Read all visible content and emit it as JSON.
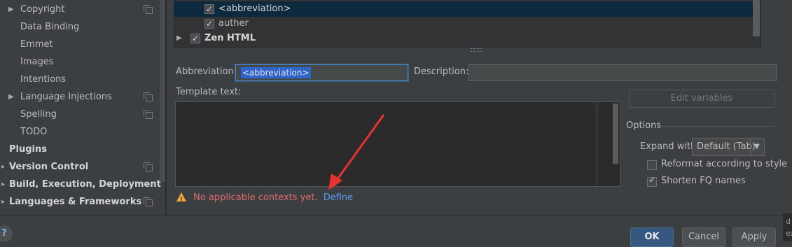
{
  "sidebar": {
    "items": [
      {
        "label": "Copyright",
        "arrow": "▶",
        "copy": true,
        "bold": false
      },
      {
        "label": "Data Binding",
        "arrow": "",
        "copy": false,
        "bold": false
      },
      {
        "label": "Emmet",
        "arrow": "",
        "copy": false,
        "bold": false
      },
      {
        "label": "Images",
        "arrow": "",
        "copy": false,
        "bold": false
      },
      {
        "label": "Intentions",
        "arrow": "",
        "copy": false,
        "bold": false
      },
      {
        "label": "Language Injections",
        "arrow": "▶",
        "copy": true,
        "bold": false
      },
      {
        "label": "Spelling",
        "arrow": "",
        "copy": true,
        "bold": false
      },
      {
        "label": "TODO",
        "arrow": "",
        "copy": false,
        "bold": false
      },
      {
        "label": "Plugins",
        "arrow": "",
        "copy": false,
        "bold": true
      },
      {
        "label": "Version Control",
        "arrow": "▸",
        "copy": true,
        "bold": true
      },
      {
        "label": "Build, Execution, Deployment",
        "arrow": "▸",
        "copy": false,
        "bold": true
      },
      {
        "label": "Languages & Frameworks",
        "arrow": "▸",
        "copy": true,
        "bold": true
      }
    ]
  },
  "tree": {
    "rows": [
      {
        "label": "<abbreviation>",
        "selected": true
      },
      {
        "label": "auther",
        "selected": false
      },
      {
        "label": "Zen HTML",
        "group": true
      }
    ]
  },
  "form": {
    "abbreviation_label": "Abbreviation:",
    "abbreviation_value": "<abbreviation>",
    "description_label": "Description:",
    "description_value": "",
    "template_label": "Template text:",
    "template_value": "",
    "edit_variables_label": "Edit variables",
    "warning_text": "No applicable contexts yet.",
    "define_link": "Define"
  },
  "options": {
    "title": "Options",
    "expand_label": "Expand with",
    "expand_value": "Default (Tab)",
    "reformat_label": "Reformat according to style",
    "reformat_checked": false,
    "shorten_label": "Shorten FQ names",
    "shorten_checked": true
  },
  "buttons": {
    "ok": "OK",
    "cancel": "Cancel",
    "apply": "Apply",
    "help": "?"
  },
  "colors": {
    "background": "#3c3f41",
    "selection": "#0d293e",
    "accent": "#4a88c7",
    "warning": "#e06c6c",
    "link": "#589df6"
  },
  "edge_text": "d\nex"
}
